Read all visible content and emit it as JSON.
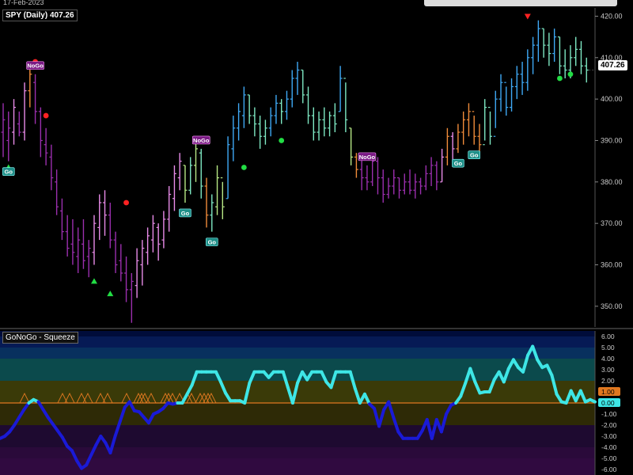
{
  "header": {
    "date": "17-Feb-2023"
  },
  "price_title": "SPY (Daily) 407.26",
  "panel_title": "GoNoGo - Squeeze",
  "last_price": "407.26",
  "colors": {
    "background": "#000000",
    "go_bright": "#3fa9f5",
    "go_light": "#7ee8c3",
    "go_fade": "#b8e986",
    "nogo_bright": "#9b2fae",
    "nogo_light": "#e88be8",
    "neutral": "#f08c3a",
    "oscillator_go": "#3ee6e6",
    "oscillator_nogo": "#1a1ad6"
  },
  "chart_data": [
    {
      "type": "ohlc",
      "title": "SPY (Daily) 407.26",
      "ylim": [
        345,
        422
      ],
      "yticks": [
        350,
        360,
        370,
        380,
        390,
        400,
        410,
        420
      ],
      "bars": [
        {
          "h": 399,
          "l": 386,
          "o": 392,
          "c": 395,
          "t": "nogo_bright"
        },
        {
          "h": 397,
          "l": 385,
          "o": 390,
          "c": 393,
          "t": "nogo_bright"
        },
        {
          "h": 400,
          "l": 389,
          "o": 392,
          "c": 398,
          "t": "nogo_light"
        },
        {
          "h": 397,
          "l": 391,
          "o": 394,
          "c": 392,
          "t": "nogo_bright"
        },
        {
          "h": 404,
          "l": 390,
          "o": 392,
          "c": 402,
          "t": "nogo_light"
        },
        {
          "h": 408,
          "l": 398,
          "o": 402,
          "c": 406,
          "t": "neutral"
        },
        {
          "h": 406,
          "l": 394,
          "o": 404,
          "c": 397,
          "t": "nogo_bright"
        },
        {
          "h": 398,
          "l": 386,
          "o": 397,
          "c": 390,
          "t": "nogo_bright"
        },
        {
          "h": 393,
          "l": 384,
          "o": 389,
          "c": 387,
          "t": "nogo_bright"
        },
        {
          "h": 389,
          "l": 378,
          "o": 386,
          "c": 381,
          "t": "nogo_bright"
        },
        {
          "h": 383,
          "l": 372,
          "o": 380,
          "c": 374,
          "t": "nogo_bright"
        },
        {
          "h": 376,
          "l": 366,
          "o": 373,
          "c": 368,
          "t": "nogo_bright"
        },
        {
          "h": 372,
          "l": 362,
          "o": 368,
          "c": 364,
          "t": "nogo_bright"
        },
        {
          "h": 371,
          "l": 360,
          "o": 365,
          "c": 363,
          "t": "nogo_bright"
        },
        {
          "h": 369,
          "l": 358,
          "o": 362,
          "c": 366,
          "t": "nogo_bright"
        },
        {
          "h": 371,
          "l": 359,
          "o": 365,
          "c": 361,
          "t": "nogo_bright"
        },
        {
          "h": 366,
          "l": 357,
          "o": 362,
          "c": 364,
          "t": "nogo_bright"
        },
        {
          "h": 372,
          "l": 360,
          "o": 363,
          "c": 370,
          "t": "nogo_light"
        },
        {
          "h": 377,
          "l": 366,
          "o": 369,
          "c": 375,
          "t": "nogo_light"
        },
        {
          "h": 378,
          "l": 367,
          "o": 375,
          "c": 372,
          "t": "nogo_light"
        },
        {
          "h": 375,
          "l": 364,
          "o": 372,
          "c": 366,
          "t": "nogo_bright"
        },
        {
          "h": 368,
          "l": 358,
          "o": 366,
          "c": 360,
          "t": "nogo_bright"
        },
        {
          "h": 365,
          "l": 356,
          "o": 361,
          "c": 358,
          "t": "nogo_bright"
        },
        {
          "h": 362,
          "l": 351,
          "o": 358,
          "c": 354,
          "t": "nogo_bright"
        },
        {
          "h": 358,
          "l": 346,
          "o": 354,
          "c": 356,
          "t": "nogo_bright"
        },
        {
          "h": 364,
          "l": 352,
          "o": 355,
          "c": 361,
          "t": "nogo_light"
        },
        {
          "h": 366,
          "l": 355,
          "o": 360,
          "c": 364,
          "t": "nogo_light"
        },
        {
          "h": 369,
          "l": 360,
          "o": 363,
          "c": 367,
          "t": "nogo_light"
        },
        {
          "h": 372,
          "l": 363,
          "o": 366,
          "c": 370,
          "t": "nogo_light"
        },
        {
          "h": 370,
          "l": 361,
          "o": 369,
          "c": 365,
          "t": "nogo_light"
        },
        {
          "h": 373,
          "l": 364,
          "o": 366,
          "c": 371,
          "t": "nogo_light"
        },
        {
          "h": 379,
          "l": 368,
          "o": 371,
          "c": 377,
          "t": "nogo_light"
        },
        {
          "h": 384,
          "l": 373,
          "o": 376,
          "c": 382,
          "t": "nogo_light"
        },
        {
          "h": 387,
          "l": 378,
          "o": 381,
          "c": 385,
          "t": "nogo_light"
        },
        {
          "h": 384,
          "l": 375,
          "o": 384,
          "c": 378,
          "t": "go_fade"
        },
        {
          "h": 386,
          "l": 377,
          "o": 378,
          "c": 384,
          "t": "go_light"
        },
        {
          "h": 390,
          "l": 380,
          "o": 384,
          "c": 388,
          "t": "go_fade"
        },
        {
          "h": 388,
          "l": 376,
          "o": 387,
          "c": 379,
          "t": "go_light"
        },
        {
          "h": 381,
          "l": 369,
          "o": 379,
          "c": 372,
          "t": "neutral"
        },
        {
          "h": 377,
          "l": 368,
          "o": 372,
          "c": 375,
          "t": "go_light"
        },
        {
          "h": 384,
          "l": 372,
          "o": 374,
          "c": 381,
          "t": "go_fade"
        },
        {
          "h": 380,
          "l": 371,
          "o": 381,
          "c": 374,
          "t": "go_fade"
        },
        {
          "h": 391,
          "l": 376,
          "o": 376,
          "c": 389,
          "t": "go_bright"
        },
        {
          "h": 396,
          "l": 385,
          "o": 388,
          "c": 393,
          "t": "go_bright"
        },
        {
          "h": 399,
          "l": 390,
          "o": 393,
          "c": 397,
          "t": "go_bright"
        },
        {
          "h": 403,
          "l": 393,
          "o": 396,
          "c": 401,
          "t": "go_bright"
        },
        {
          "h": 401,
          "l": 394,
          "o": 401,
          "c": 396,
          "t": "go_light"
        },
        {
          "h": 398,
          "l": 391,
          "o": 396,
          "c": 394,
          "t": "go_light"
        },
        {
          "h": 396,
          "l": 388,
          "o": 394,
          "c": 391,
          "t": "go_light"
        },
        {
          "h": 395,
          "l": 389,
          "o": 391,
          "c": 393,
          "t": "go_light"
        },
        {
          "h": 398,
          "l": 391,
          "o": 393,
          "c": 396,
          "t": "go_bright"
        },
        {
          "h": 401,
          "l": 394,
          "o": 396,
          "c": 399,
          "t": "go_bright"
        },
        {
          "h": 400,
          "l": 394,
          "o": 399,
          "c": 397,
          "t": "go_light"
        },
        {
          "h": 402,
          "l": 395,
          "o": 397,
          "c": 400,
          "t": "go_bright"
        },
        {
          "h": 407,
          "l": 398,
          "o": 400,
          "c": 405,
          "t": "go_bright"
        },
        {
          "h": 409,
          "l": 401,
          "o": 405,
          "c": 407,
          "t": "go_bright"
        },
        {
          "h": 407,
          "l": 399,
          "o": 407,
          "c": 401,
          "t": "go_light"
        },
        {
          "h": 403,
          "l": 394,
          "o": 401,
          "c": 396,
          "t": "go_light"
        },
        {
          "h": 398,
          "l": 390,
          "o": 396,
          "c": 392,
          "t": "go_light"
        },
        {
          "h": 397,
          "l": 390,
          "o": 392,
          "c": 395,
          "t": "go_light"
        },
        {
          "h": 398,
          "l": 391,
          "o": 395,
          "c": 393,
          "t": "go_light"
        },
        {
          "h": 397,
          "l": 391,
          "o": 393,
          "c": 396,
          "t": "go_light"
        },
        {
          "h": 399,
          "l": 392,
          "o": 396,
          "c": 394,
          "t": "go_light"
        },
        {
          "h": 408,
          "l": 397,
          "o": 397,
          "c": 405,
          "t": "go_bright"
        },
        {
          "h": 404,
          "l": 392,
          "o": 405,
          "c": 395,
          "t": "go_light"
        },
        {
          "h": 393,
          "l": 384,
          "o": 393,
          "c": 386,
          "t": "go_fade"
        },
        {
          "h": 387,
          "l": 381,
          "o": 386,
          "c": 383,
          "t": "neutral"
        },
        {
          "h": 386,
          "l": 378,
          "o": 383,
          "c": 381,
          "t": "nogo_bright"
        },
        {
          "h": 384,
          "l": 378,
          "o": 381,
          "c": 380,
          "t": "nogo_bright"
        },
        {
          "h": 387,
          "l": 379,
          "o": 380,
          "c": 385,
          "t": "nogo_bright"
        },
        {
          "h": 386,
          "l": 377,
          "o": 385,
          "c": 381,
          "t": "nogo_bright"
        },
        {
          "h": 383,
          "l": 375,
          "o": 381,
          "c": 377,
          "t": "nogo_bright"
        },
        {
          "h": 381,
          "l": 376,
          "o": 377,
          "c": 379,
          "t": "nogo_bright"
        },
        {
          "h": 383,
          "l": 377,
          "o": 379,
          "c": 381,
          "t": "nogo_bright"
        },
        {
          "h": 381,
          "l": 376,
          "o": 381,
          "c": 378,
          "t": "nogo_bright"
        },
        {
          "h": 382,
          "l": 377,
          "o": 378,
          "c": 380,
          "t": "nogo_bright"
        },
        {
          "h": 383,
          "l": 377,
          "o": 380,
          "c": 378,
          "t": "nogo_bright"
        },
        {
          "h": 382,
          "l": 376,
          "o": 378,
          "c": 380,
          "t": "nogo_bright"
        },
        {
          "h": 381,
          "l": 377,
          "o": 380,
          "c": 379,
          "t": "nogo_bright"
        },
        {
          "h": 384,
          "l": 378,
          "o": 379,
          "c": 382,
          "t": "nogo_bright"
        },
        {
          "h": 386,
          "l": 379,
          "o": 382,
          "c": 384,
          "t": "nogo_bright"
        },
        {
          "h": 385,
          "l": 378,
          "o": 384,
          "c": 380,
          "t": "nogo_bright"
        },
        {
          "h": 388,
          "l": 380,
          "o": 380,
          "c": 386,
          "t": "nogo_light"
        },
        {
          "h": 393,
          "l": 384,
          "o": 386,
          "c": 391,
          "t": "neutral"
        },
        {
          "h": 392,
          "l": 385,
          "o": 391,
          "c": 388,
          "t": "nogo_light"
        },
        {
          "h": 394,
          "l": 387,
          "o": 388,
          "c": 392,
          "t": "neutral"
        },
        {
          "h": 397,
          "l": 389,
          "o": 392,
          "c": 395,
          "t": "neutral"
        },
        {
          "h": 399,
          "l": 391,
          "o": 395,
          "c": 397,
          "t": "neutral"
        },
        {
          "h": 396,
          "l": 389,
          "o": 397,
          "c": 391,
          "t": "neutral"
        },
        {
          "h": 394,
          "l": 387,
          "o": 391,
          "c": 389,
          "t": "neutral"
        },
        {
          "h": 400,
          "l": 390,
          "o": 389,
          "c": 398,
          "t": "go_light"
        },
        {
          "h": 397,
          "l": 389,
          "o": 398,
          "c": 391,
          "t": "go_light"
        },
        {
          "h": 402,
          "l": 393,
          "o": 391,
          "c": 400,
          "t": "go_bright"
        },
        {
          "h": 406,
          "l": 397,
          "o": 400,
          "c": 404,
          "t": "go_bright"
        },
        {
          "h": 403,
          "l": 396,
          "o": 404,
          "c": 398,
          "t": "go_bright"
        },
        {
          "h": 405,
          "l": 397,
          "o": 398,
          "c": 403,
          "t": "go_bright"
        },
        {
          "h": 408,
          "l": 400,
          "o": 403,
          "c": 406,
          "t": "go_bright"
        },
        {
          "h": 409,
          "l": 401,
          "o": 406,
          "c": 404,
          "t": "go_bright"
        },
        {
          "h": 412,
          "l": 402,
          "o": 404,
          "c": 410,
          "t": "go_bright"
        },
        {
          "h": 415,
          "l": 406,
          "o": 410,
          "c": 413,
          "t": "go_bright"
        },
        {
          "h": 419,
          "l": 409,
          "o": 413,
          "c": 417,
          "t": "go_bright"
        },
        {
          "h": 417,
          "l": 410,
          "o": 417,
          "c": 413,
          "t": "go_light"
        },
        {
          "h": 416,
          "l": 408,
          "o": 413,
          "c": 411,
          "t": "go_light"
        },
        {
          "h": 417,
          "l": 409,
          "o": 411,
          "c": 415,
          "t": "go_bright"
        },
        {
          "h": 415,
          "l": 406,
          "o": 415,
          "c": 408,
          "t": "go_light"
        },
        {
          "h": 412,
          "l": 405,
          "o": 408,
          "c": 407,
          "t": "go_light"
        },
        {
          "h": 413,
          "l": 405,
          "o": 407,
          "c": 410,
          "t": "go_light"
        },
        {
          "h": 415,
          "l": 408,
          "o": 410,
          "c": 412,
          "t": "go_light"
        },
        {
          "h": 414,
          "l": 406,
          "o": 412,
          "c": 408,
          "t": "go_light"
        },
        {
          "h": 410,
          "l": 404,
          "o": 408,
          "c": 407,
          "t": "go_light"
        }
      ],
      "labels": [
        {
          "i": 1,
          "text": "Go",
          "type": "go"
        },
        {
          "i": 6,
          "text": "NoGo",
          "type": "nogo"
        },
        {
          "i": 34,
          "text": "Go",
          "type": "go"
        },
        {
          "i": 37,
          "text": "NoGo",
          "type": "nogo"
        },
        {
          "i": 39,
          "text": "Go",
          "type": "go"
        },
        {
          "i": 68,
          "text": "NoGo",
          "type": "nogo"
        },
        {
          "i": 85,
          "text": "Go",
          "type": "go"
        },
        {
          "i": 88,
          "text": "Go",
          "type": "go"
        }
      ],
      "markers": [
        {
          "i": 1,
          "price": 383.5,
          "shape": "triangle-up",
          "color": "#22dd44"
        },
        {
          "i": 6,
          "price": 409,
          "shape": "circle",
          "color": "#ff2222"
        },
        {
          "i": 8,
          "price": 396,
          "shape": "circle",
          "color": "#ff2222"
        },
        {
          "i": 17,
          "price": 356,
          "shape": "triangle-up",
          "color": "#22dd44"
        },
        {
          "i": 20,
          "price": 353,
          "shape": "triangle-up",
          "color": "#22dd44"
        },
        {
          "i": 23,
          "price": 375,
          "shape": "circle",
          "color": "#ff2222"
        },
        {
          "i": 45,
          "price": 383.5,
          "shape": "circle",
          "color": "#22dd44"
        },
        {
          "i": 52,
          "price": 390,
          "shape": "circle",
          "color": "#22dd44"
        },
        {
          "i": 98,
          "price": 420,
          "shape": "triangle-down",
          "color": "#ff2222"
        },
        {
          "i": 104,
          "price": 405,
          "shape": "circle",
          "color": "#22dd44"
        },
        {
          "i": 106,
          "price": 406,
          "shape": "circle",
          "color": "#22dd44"
        }
      ]
    },
    {
      "type": "line",
      "title": "GoNoGo - Squeeze",
      "ylim": [
        -6.5,
        6.5
      ],
      "yticks": [
        "6.00",
        "5.00",
        "4.00",
        "3.00",
        "2.00",
        "1.00",
        "0.00",
        "-1.00",
        "-2.00",
        "-3.00",
        "-4.00",
        "-5.00",
        "-6.00"
      ],
      "marked_values": [
        "1.00",
        "0.00"
      ],
      "values": [
        -3.2,
        -3,
        -2.6,
        -2,
        -1.3,
        -0.6,
        0,
        0.3,
        0.1,
        -0.6,
        -1.3,
        -1.9,
        -2.5,
        -3.1,
        -3.9,
        -4.3,
        -5.2,
        -5.9,
        -5.6,
        -4.7,
        -3.8,
        -3,
        -3.6,
        -4.5,
        -3,
        -1.7,
        -0.4,
        0.1,
        -0.7,
        -0.8,
        -1.3,
        -1.8,
        -1,
        -0.8,
        -0.5,
        0,
        -0.1,
        0,
        0,
        0.8,
        1.6,
        2.8,
        2.8,
        2.8,
        2.8,
        2.8,
        1.9,
        0.9,
        0.2,
        0.2,
        0.2,
        0,
        1.8,
        2.8,
        2.8,
        2.8,
        2.3,
        2.8,
        2.8,
        2.8,
        1.4,
        0,
        1.8,
        2.8,
        2.1,
        2.8,
        2.8,
        2.8,
        1.9,
        1.4,
        2.8,
        2.8,
        2.8,
        2.8,
        1.3,
        0,
        0.8,
        -0.1,
        -0.5,
        -2.1,
        -0.6,
        0.1,
        -1.3,
        -2.6,
        -3.2,
        -3.2,
        -3.2,
        -3.2,
        -2.5,
        -1.5,
        -3.2,
        -1.5,
        -2.6,
        -1,
        -0.2,
        0,
        0.6,
        1.8,
        3.1,
        1.9,
        0.9,
        1,
        1,
        2.1,
        2.8,
        1.9,
        3.1,
        3.9,
        3.2,
        2.8,
        4.3,
        5.1,
        3.9,
        3.2,
        3.4,
        2.5,
        0.8,
        0.1,
        0,
        1.1,
        0.2,
        1.1,
        0.1,
        0.3,
        0.1
      ],
      "oscillator_colors": {
        "above": "oscillator_go",
        "below": "oscillator_nogo"
      },
      "squeeze_peaks": [
        31,
        79,
        88,
        103,
        111,
        127,
        136,
        160,
        175,
        179,
        183,
        191,
        209,
        213,
        218,
        227,
        237,
        242,
        253,
        258,
        263,
        267
      ]
    }
  ]
}
